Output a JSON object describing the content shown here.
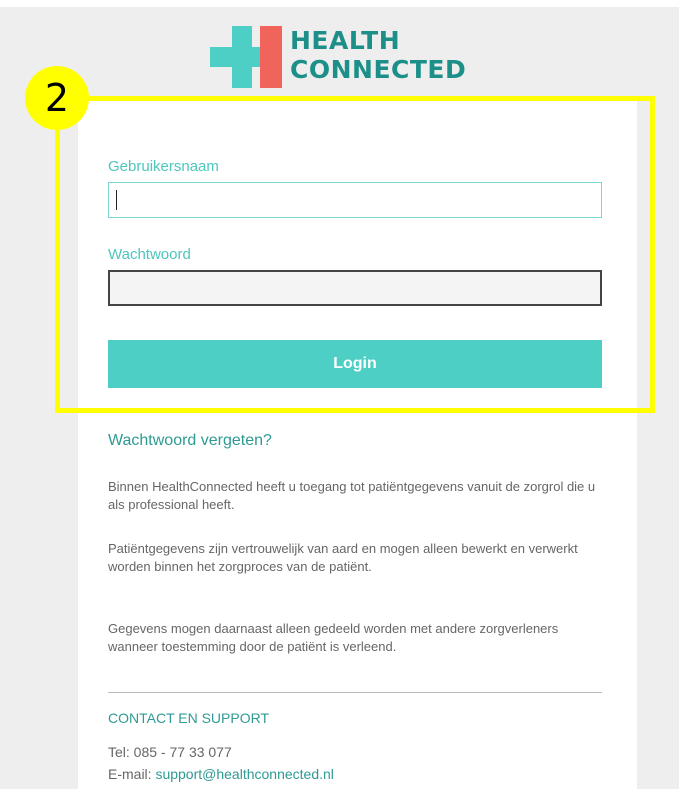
{
  "logo": {
    "line1": "HEALTH",
    "line2": "CONNECTED",
    "colors": {
      "teal": "#4ecfc6",
      "red": "#f0645c",
      "dark_teal": "#1c8f88"
    }
  },
  "annotation": {
    "step_number": "2",
    "color": "#ffff00"
  },
  "form": {
    "username_label": "Gebruikersnaam",
    "username_value": "",
    "password_label": "Wachtwoord",
    "password_value": "",
    "login_label": "Login"
  },
  "forgot_password": "Wachtwoord vergeten?",
  "info": {
    "p1": "Binnen HealthConnected heeft u toegang tot patiëntgegevens vanuit de zorgrol die u als professional heeft.",
    "p2": "Patiëntgegevens zijn vertrouwelijk van aard en mogen alleen bewerkt en verwerkt worden binnen het zorgproces van de patiënt.",
    "p3": "Gegevens mogen daarnaast alleen gedeeld worden met andere zorgverleners wanneer toestemming door de patiënt is verleend."
  },
  "contact": {
    "title": "CONTACT EN SUPPORT",
    "tel": "Tel: 085 - 77 33 077",
    "email_label": "E-mail: ",
    "email": "support@healthconnected.nl"
  }
}
